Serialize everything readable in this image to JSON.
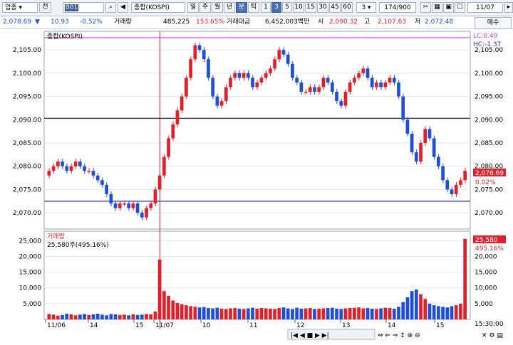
{
  "toolbar": {
    "market": "업종",
    "market_jeon": "전",
    "code": "001",
    "name": "종합(KOSPI)",
    "periods": [
      "일",
      "주",
      "월",
      "년",
      "분",
      "틱"
    ],
    "active_period": "분",
    "intervals": [
      "1",
      "3",
      "5",
      "10",
      "15",
      "30",
      "45",
      "60"
    ],
    "active_interval": "3",
    "interval_select": "3",
    "count": "174/900",
    "date": "11/07"
  },
  "info": {
    "price": "2,078.69",
    "change": "10.93",
    "change_pct": "-0.52%",
    "volume_label": "거래량",
    "volume": "485,225",
    "volume_ratio": "153.65%",
    "amount_label": "거래대금",
    "amount": "6,452,003백만",
    "open_label": "시",
    "open": "2,090.32",
    "high_label": "고",
    "high": "2,107.63",
    "low_label": "저",
    "low": "2,072.48",
    "buy_label": "매수"
  },
  "price_panel": {
    "title": "종합(KOSPI)",
    "lc": "LC:0.49",
    "hc": "HC:-1.37",
    "current_tag": "2,078.69",
    "current_pct": "0.02%",
    "y_ticks": [
      "2,105.00",
      "2,100.00",
      "2,095.00",
      "2,090.00",
      "2,085.00",
      "2,080.00",
      "2,075.00",
      "2,070.00"
    ]
  },
  "volume_panel": {
    "title": "거래량",
    "info": "25,580주(495.16%)",
    "current_tag": "25,580",
    "current_pct": "495.16%",
    "y_ticks": [
      "25,000",
      "20,000",
      "15,000",
      "10,000",
      "5,000"
    ]
  },
  "x_axis": {
    "labels": [
      "11/06",
      "14",
      "15",
      "11/07",
      "10",
      "11",
      "12",
      "13",
      "14",
      "15"
    ],
    "time": "15:30:00"
  },
  "colors": {
    "up": "#e0202a",
    "down": "#1f4fd6",
    "line_high": "#d13fd1",
    "line_low": "#2f2fb5",
    "line_mid": "#000000",
    "divider": "#c8202a"
  },
  "chart_data": {
    "type": "candlestick",
    "price_levels": {
      "high_line": 2107.63,
      "mid_line": 2090.32,
      "low_line": 2072.48
    },
    "close_path": [
      2079,
      2080,
      2081,
      2080,
      2079,
      2080,
      2081,
      2080,
      2079,
      2079,
      2078,
      2077,
      2076,
      2074,
      2072,
      2071,
      2072,
      2072,
      2071,
      2072,
      2070,
      2069,
      2071,
      2072,
      2075,
      2078,
      2082,
      2086,
      2089,
      2092,
      2095,
      2099,
      2103,
      2106,
      2105,
      2103,
      2099,
      2095,
      2093,
      2094,
      2097,
      2099,
      2100,
      2099,
      2100,
      2099,
      2097,
      2098,
      2099,
      2100,
      2101,
      2103,
      2105,
      2104,
      2102,
      2099,
      2098,
      2096,
      2096,
      2097,
      2096,
      2097,
      2099,
      2098,
      2096,
      2094,
      2093,
      2096,
      2098,
      2099,
      2100,
      2101,
      2099,
      2097,
      2098,
      2097,
      2098,
      2099,
      2098,
      2095,
      2090,
      2087,
      2083,
      2081,
      2085,
      2088,
      2086,
      2082,
      2080,
      2077,
      2075,
      2074,
      2076,
      2077,
      2079
    ],
    "volume_path": [
      1700,
      1500,
      1200,
      1400,
      1800,
      1600,
      1300,
      1500,
      1700,
      1400,
      1600,
      1800,
      1500,
      1300,
      1700,
      1600,
      1400,
      1500,
      1300,
      1600,
      1400,
      1500,
      1700,
      1600,
      2500,
      19000,
      9000,
      7500,
      6000,
      5200,
      4800,
      4500,
      4200,
      4000,
      3800,
      3900,
      3600,
      3500,
      3700,
      3400,
      3300,
      3500,
      3600,
      3400,
      3300,
      3500,
      3700,
      3400,
      3600,
      3500,
      3400,
      3300,
      3600,
      3800,
      3500,
      3300,
      3700,
      3400,
      3500,
      3600,
      3300,
      3400,
      3500,
      3600,
      3700,
      3400,
      3300,
      3500,
      3600,
      3700,
      3800,
      3500,
      3600,
      3400,
      3300,
      3500,
      3700,
      3600,
      3400,
      4000,
      5500,
      7000,
      9000,
      9500,
      8000,
      6500,
      5000,
      4500,
      4200,
      4000,
      3800,
      4200,
      4500,
      5000,
      25580
    ]
  }
}
